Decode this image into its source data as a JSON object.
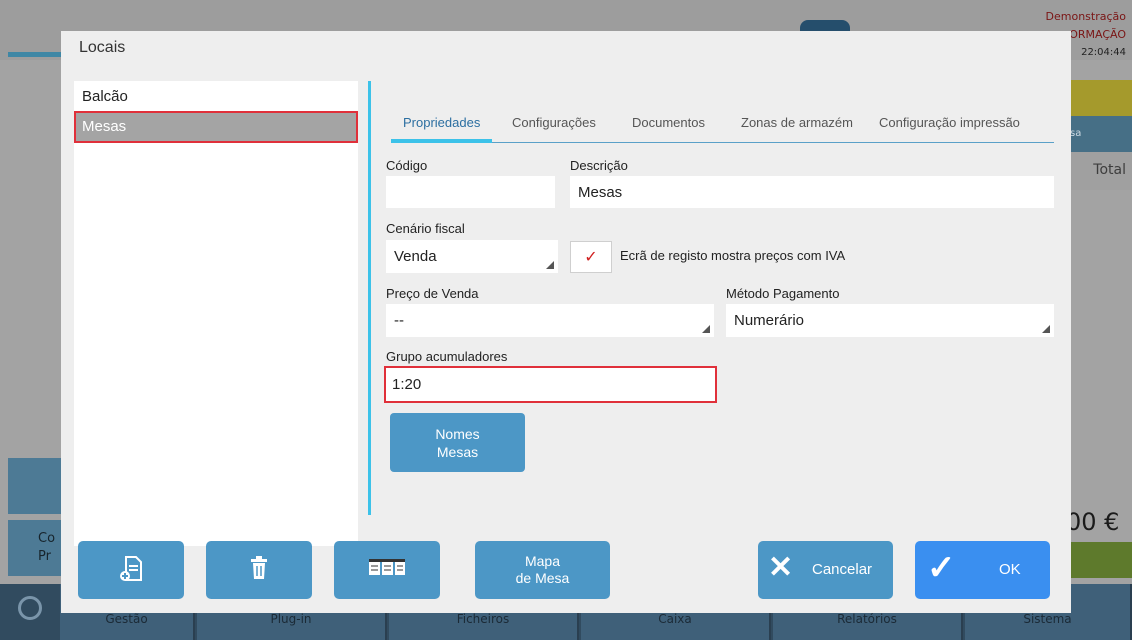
{
  "background": {
    "demo_label": "Demonstração",
    "formacao_label": "ORMAÇÃO",
    "clock": "22:04:44",
    "side_tab_label": "sa",
    "total_label": "Total",
    "price_text": "00 €",
    "left_btn_label": "Co Pr",
    "bottom_menu": [
      "Gestão",
      "Plug-in",
      "Ficheiros",
      "Caixa",
      "Relatórios",
      "Sistema"
    ]
  },
  "dialog": {
    "title": "Locais",
    "locations": [
      "Balcão",
      "Mesas"
    ],
    "selected_location": "Mesas",
    "tabs": [
      "Propriedades",
      "Configurações",
      "Documentos",
      "Zonas de armazém",
      "Configuração impressão"
    ],
    "active_tab": "Propriedades",
    "form": {
      "codigo_label": "Código",
      "codigo_value": "",
      "descricao_label": "Descrição",
      "descricao_value": "Mesas",
      "cenario_label": "Cenário fiscal",
      "cenario_value": "Venda",
      "iva_checked_mark": "✓",
      "iva_label": "Ecrã de registo mostra preços com IVA",
      "preco_label": "Preço de Venda",
      "preco_value": "--",
      "metodo_label": "Método Pagamento",
      "metodo_value": "Numerário",
      "grupo_label": "Grupo acumuladores",
      "grupo_value": "1:20",
      "nomes_mesas_line1": "Nomes",
      "nomes_mesas_line2": "Mesas"
    },
    "footer": {
      "new_icon": "new-document-icon",
      "delete_icon": "trash-icon",
      "columns_icon": "columns-icon",
      "mapa_line1": "Mapa",
      "mapa_line2": "de Mesa",
      "cancel_label": "Cancelar",
      "ok_label": "OK"
    }
  }
}
